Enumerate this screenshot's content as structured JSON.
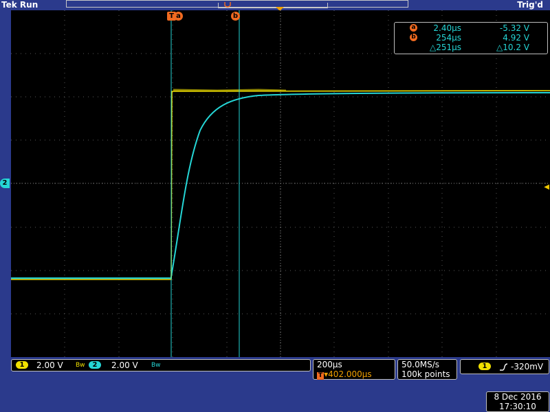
{
  "header": {
    "brand": "Tek",
    "state": "Run",
    "trigger_status": "Trig'd"
  },
  "cursor_readout": {
    "a": {
      "marker": "a",
      "time": "2.40µs",
      "value": "-5.32 V"
    },
    "b": {
      "marker": "b",
      "time": "254µs",
      "value": "4.92 V"
    },
    "delta": {
      "time": "△251µs",
      "value": "△10.2 V"
    }
  },
  "cursor_labels": {
    "trigger": "T",
    "a": "a",
    "b": "b"
  },
  "channels": [
    {
      "number": "1",
      "scale": "2.00 V",
      "bw": "Bw",
      "color": "#f0e000"
    },
    {
      "number": "2",
      "scale": "2.00 V",
      "bw": "Bw",
      "color": "#25d6d6"
    }
  ],
  "timebase": {
    "scale": "200µs",
    "trigger_badge": "T",
    "position": "402.000µs"
  },
  "acquisition": {
    "rate": "50.0MS/s",
    "points": "100k points"
  },
  "trigger": {
    "source": "1",
    "slope_icon": "rising-edge-icon",
    "level": "-320mV"
  },
  "datetime": {
    "date": "8 Dec  2016",
    "time": "17:30:10"
  },
  "side_marker": "2",
  "colors": {
    "ch1": "#f0e000",
    "ch2": "#25d6d6",
    "cursor": "#25d6d6",
    "marker": "#f06a20",
    "trigger": "#f0c800"
  }
}
